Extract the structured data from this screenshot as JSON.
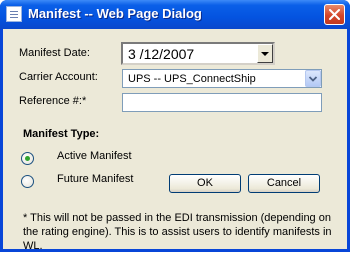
{
  "window": {
    "title": "Manifest -- Web Page Dialog"
  },
  "form": {
    "manifest_date_label": "Manifest Date:",
    "manifest_date_value": "3 /12/2007",
    "carrier_account_label": "Carrier Account:",
    "carrier_account_value": "UPS -- UPS_ConnectShip",
    "reference_label": "Reference #:*",
    "reference_value": ""
  },
  "manifest_type": {
    "heading": "Manifest Type:",
    "options": [
      {
        "label": "Active Manifest",
        "selected": true
      },
      {
        "label": "Future Manifest",
        "selected": false
      }
    ]
  },
  "buttons": {
    "ok": "OK",
    "cancel": "Cancel"
  },
  "note": "* This will not be passed in the EDI transmission (depending on the rating engine). This is to assist users to identify manifests in WL.",
  "colors": {
    "titlebar": "#0453e0",
    "client": "#ece9d8",
    "close": "#d4462a",
    "radio_dot": "#2fa32f"
  },
  "icons": [
    "app-page-icon",
    "close-icon",
    "chevron-down-icon"
  ]
}
